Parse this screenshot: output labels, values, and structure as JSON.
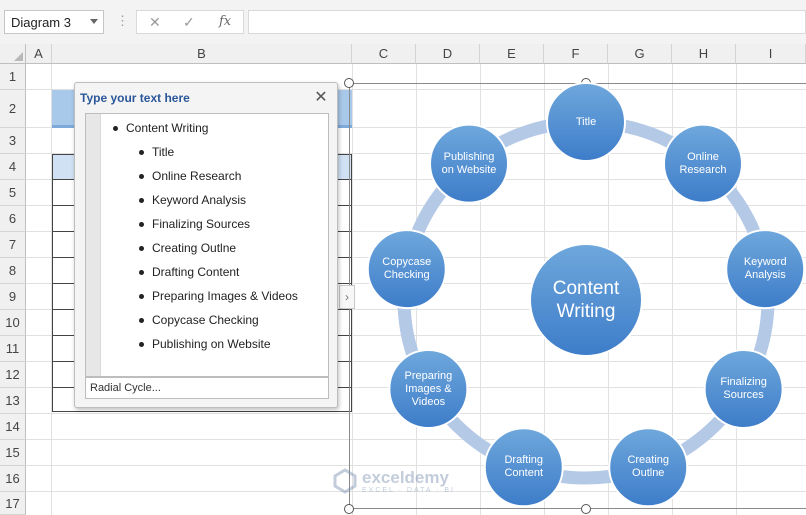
{
  "formula_bar": {
    "name_box": "Diagram 3",
    "fx_label": "fx",
    "cancel_glyph": "✕",
    "enter_glyph": "✓",
    "dots_glyph": "⋮",
    "formula": ""
  },
  "columns": [
    "A",
    "B",
    "C",
    "D",
    "E",
    "F",
    "G",
    "H",
    "I"
  ],
  "rows": [
    "1",
    "2",
    "3",
    "4",
    "5",
    "6",
    "7",
    "8",
    "9",
    "10",
    "11",
    "12",
    "13",
    "14",
    "15",
    "16",
    "17"
  ],
  "text_pane": {
    "title": "Type your text here",
    "close_glyph": "✕",
    "items": [
      {
        "level": 1,
        "text": "Content Writing"
      },
      {
        "level": 2,
        "text": "Title"
      },
      {
        "level": 2,
        "text": "Online Research"
      },
      {
        "level": 2,
        "text": "Keyword Analysis"
      },
      {
        "level": 2,
        "text": "Finalizing Sources"
      },
      {
        "level": 2,
        "text": "Creating Outlne"
      },
      {
        "level": 2,
        "text": "Drafting Content"
      },
      {
        "level": 2,
        "text": "Preparing Images & Videos"
      },
      {
        "level": 2,
        "text": "Copycase Checking"
      },
      {
        "level": 2,
        "text": "Publishing on Website"
      }
    ],
    "footer": "Radial Cycle..."
  },
  "expand_glyph": "›",
  "smartart": {
    "center": "Content Writing",
    "nodes": [
      "Title",
      "Online Research",
      "Keyword Analysis",
      "Finalizing Sources",
      "Creating Outlne",
      "Drafting Content",
      "Preparing Images & Videos",
      "Copycase Checking",
      "Publishing on Website"
    ],
    "colors": {
      "node_fill_top": "#6fa8dc",
      "node_fill_bottom": "#3d7cc9",
      "ring": "#b4c9e6"
    }
  },
  "watermark": {
    "name": "exceldemy",
    "tagline": "EXCEL · DATA · BI"
  },
  "icons": {
    "name_box_dropdown": "chevron-down-icon",
    "cancel": "close-icon",
    "enter": "check-icon",
    "function": "fx-icon",
    "pane_close": "close-icon",
    "expand_tab": "chevron-right-icon",
    "watermark_logo": "exceldemy-logo"
  }
}
